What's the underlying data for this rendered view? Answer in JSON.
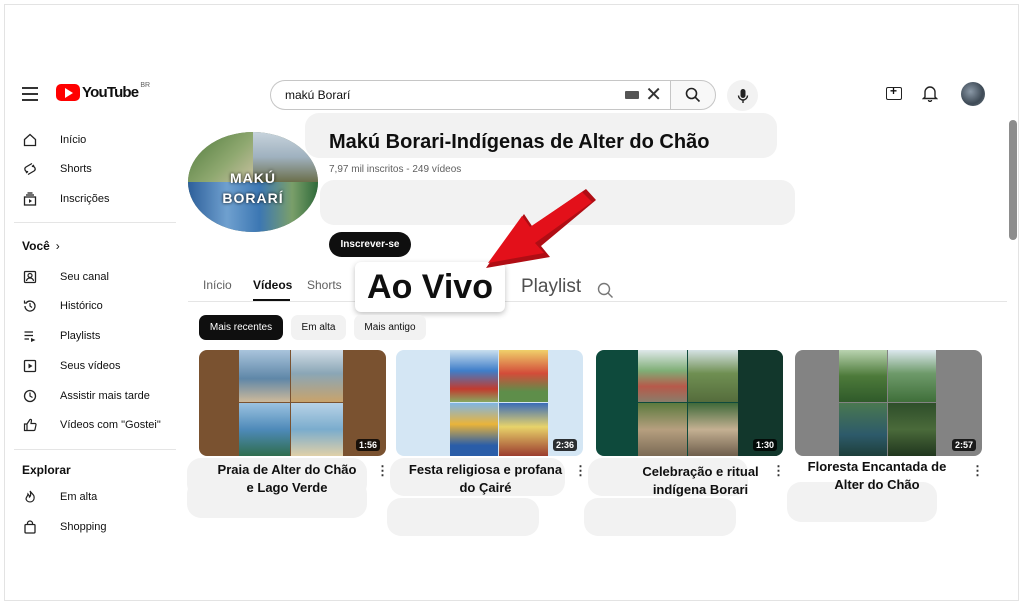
{
  "header": {
    "logo_text": "YouTube",
    "logo_region": "BR",
    "search_value": "makú Borarí"
  },
  "sidebar": {
    "main": [
      {
        "label": "Início",
        "icon": "home-icon"
      },
      {
        "label": "Shorts",
        "icon": "shorts-icon"
      },
      {
        "label": "Inscrições",
        "icon": "subscriptions-icon"
      }
    ],
    "you_heading": "Você",
    "you_items": [
      {
        "label": "Seu canal",
        "icon": "your-channel-icon"
      },
      {
        "label": "Histórico",
        "icon": "history-icon"
      },
      {
        "label": "Playlists",
        "icon": "playlists-icon"
      },
      {
        "label": "Seus vídeos",
        "icon": "your-videos-icon"
      },
      {
        "label": "Assistir mais tarde",
        "icon": "watch-later-icon"
      },
      {
        "label": "Vídeos com \"Gostei\"",
        "icon": "liked-icon"
      }
    ],
    "explore_heading": "Explorar",
    "explore_items": [
      {
        "label": "Em alta",
        "icon": "trending-icon"
      },
      {
        "label": "Shopping",
        "icon": "shopping-icon"
      }
    ]
  },
  "channel": {
    "avatar_text_1": "MAKÚ",
    "avatar_text_2": "BORARÍ",
    "title": "Makú Borari-Indígenas de Alter do Chão",
    "meta": "7,97 mil inscritos - 249 vídeos",
    "subscribe_label": "Inscrever-se"
  },
  "tabs": {
    "inicio": "Início",
    "videos": "Vídeos",
    "shorts": "Shorts",
    "ao_vivo": "Ao Vivo",
    "playlist": "Playlist"
  },
  "chips": [
    "Mais recentes",
    "Em alta",
    "Mais antigo"
  ],
  "videos": [
    {
      "title_1": "Praia de Alter do Chão",
      "title_2": "e Lago Verde",
      "duration": "1:56"
    },
    {
      "title_1": "Festa religiosa e profana",
      "title_2": "do Çairé",
      "duration": "2:36"
    },
    {
      "title_1": "Celebração e ritual",
      "title_2": "indígena Borari",
      "duration": "1:30"
    },
    {
      "title_1": "Floresta Encantada de",
      "title_2": "Alter do Chão",
      "duration": "2:57"
    }
  ],
  "colors": {
    "brand_red": "#ff0000",
    "arrow_red": "#e3101a",
    "chip_active": "#0f0f0f"
  }
}
